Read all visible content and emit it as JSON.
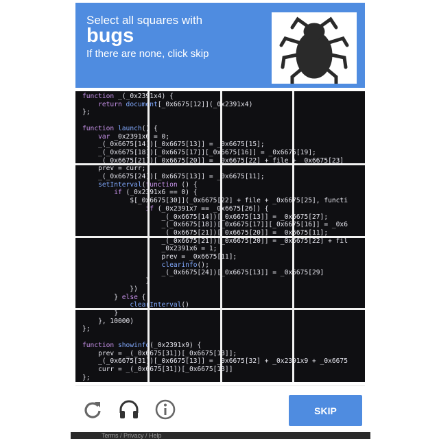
{
  "header": {
    "instruction": "Select all squares with",
    "target": "bugs",
    "hint": "If there are none, click skip",
    "example_icon": "bug-icon"
  },
  "code_lines": [
    "function _(_0x2391x4) {",
    "    return document[_0x6675[12]](_0x2391x4)",
    "};",
    "",
    "function launch() {",
    "    var _0x2391x6 = 0;",
    "    _(_0x6675[14])[_0x6675[13]] = _0x6675[15];",
    "    _(_0x6675[18])[_0x6675[17]][_0x6675[16]] = _0x6675[19];",
    "    _(_0x6675[21])[_0x6675[20]] = _0x6675[22] + file + _0x6675[23]",
    "    prev = curr;",
    "    _(_0x6675[24])[_0x6675[13]] = _0x6675[11];",
    "    setInterval(function () {",
    "        if (_0x2391x6 == 0) {",
    "            $[_0x6675[30]](_0x6675[22] + file + _0x6675[25], functi",
    "                if (_0x2391x7 == _0x6675[26]) {",
    "                    _(_0x6675[14])[_0x6675[13]] = _0x6675[27];",
    "                    _(_0x6675[18])[_0x6675[17]][_0x6675[16]] = _0x6",
    "                    _(_0x6675[21])[_0x6675[20]] = _0x6675[11];",
    "                    _(_0x6675[21])[_0x6675[20]] = _0x6675[22] + fil",
    "                    _0x2391x6 = 1;",
    "                    prev = _0x6675[11];",
    "                    clearinfo();",
    "                    _(_0x6675[24])[_0x6675[13]] = _0x6675[29]",
    "                }",
    "            })",
    "        } else {",
    "            clearInterval()",
    "        }",
    "    }, 10000)",
    "};",
    "",
    "function showinfo(_0x2391x9) {",
    "    prev = _(_0x6675[31])[_0x6675[13]];",
    "    _(_0x6675[31])[_0x6675[13]] = _0x6675[32] + _0x2391x9 + _0x6675",
    "    curr = _(_0x6675[31])[_0x6675[13]]",
    "};"
  ],
  "footer": {
    "reload_icon": "reload-icon",
    "audio_icon": "headphones-icon",
    "info_icon": "info-icon",
    "skip_label": "SKIP"
  },
  "below_text": "Terms / Privacy / Help",
  "colors": {
    "accent": "#4f8ce0",
    "code_bg": "#0f0f12",
    "keyword": "#c792ea",
    "function": "#82aaff"
  }
}
